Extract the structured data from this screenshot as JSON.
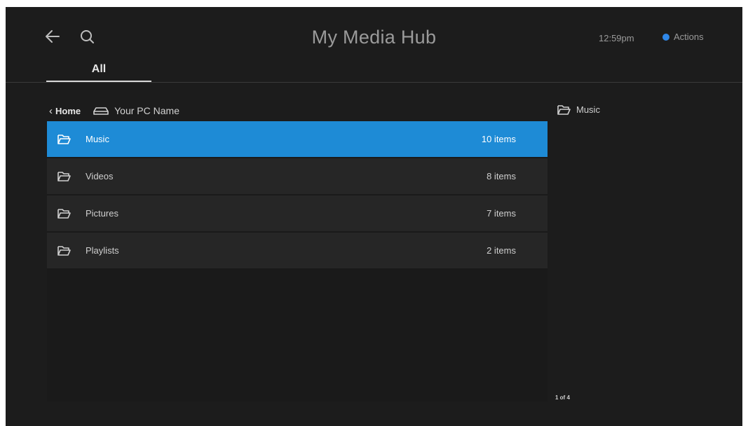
{
  "header": {
    "title": "My Media Hub",
    "time": "12:59pm",
    "actions_label": "Actions",
    "tab_all": "All",
    "accent_color": "#2f87e8"
  },
  "breadcrumb": {
    "home_label": "Home",
    "pc_label": "Your PC Name"
  },
  "folders": [
    {
      "name": "Music",
      "count": "10 items",
      "selected": true
    },
    {
      "name": "Videos",
      "count": "8 items",
      "selected": false
    },
    {
      "name": "Pictures",
      "count": "7 items",
      "selected": false
    },
    {
      "name": "Playlists",
      "count": "2 items",
      "selected": false
    }
  ],
  "preview": {
    "folder_label": "Music",
    "pager": "1 of 4"
  },
  "icons": {
    "back": "arrow-left-icon",
    "search": "search-icon",
    "folder": "folder-icon",
    "pc": "pc-drive-icon"
  }
}
